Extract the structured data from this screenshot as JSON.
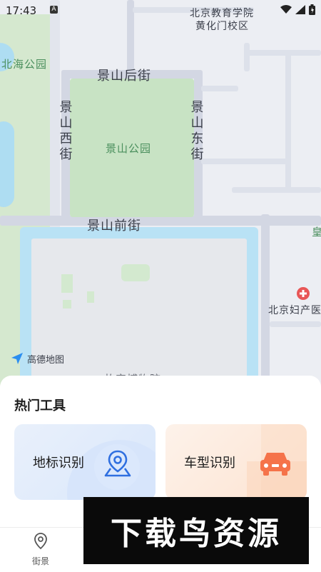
{
  "status_bar": {
    "time": "17:43",
    "notification_icon": "a-icon",
    "icons": [
      "wifi-icon",
      "signal-icon",
      "battery-icon"
    ]
  },
  "map": {
    "provider_logo": "高德地图",
    "labels": {
      "school": "北京教育学院",
      "school_campus": "黄化门校区",
      "beihai": "北海公园",
      "jingshan_hou": "景山后街",
      "jingshan_xi": "景山西街",
      "jingshan_dong": "景山东街",
      "jingshan_park": "景山公园",
      "jingshan_qian": "景山前街",
      "hospital": "北京妇产医",
      "edge_char": "皇",
      "palace_partial": "故宫博物院"
    }
  },
  "sheet": {
    "title": "热门工具",
    "tools": [
      {
        "label": "地标识别",
        "icon": "map-pin-icon",
        "accent": "#2f6fe0"
      },
      {
        "label": "车型识别",
        "icon": "car-icon",
        "accent": "#f5734a"
      }
    ]
  },
  "bottom_nav": {
    "items": [
      {
        "label": "街景",
        "icon": "location-pin-icon"
      },
      {
        "label": "",
        "icon": ""
      },
      {
        "label": "",
        "icon": ""
      },
      {
        "label": "",
        "icon": ""
      }
    ]
  },
  "watermark": {
    "text": "下载鸟资源"
  }
}
